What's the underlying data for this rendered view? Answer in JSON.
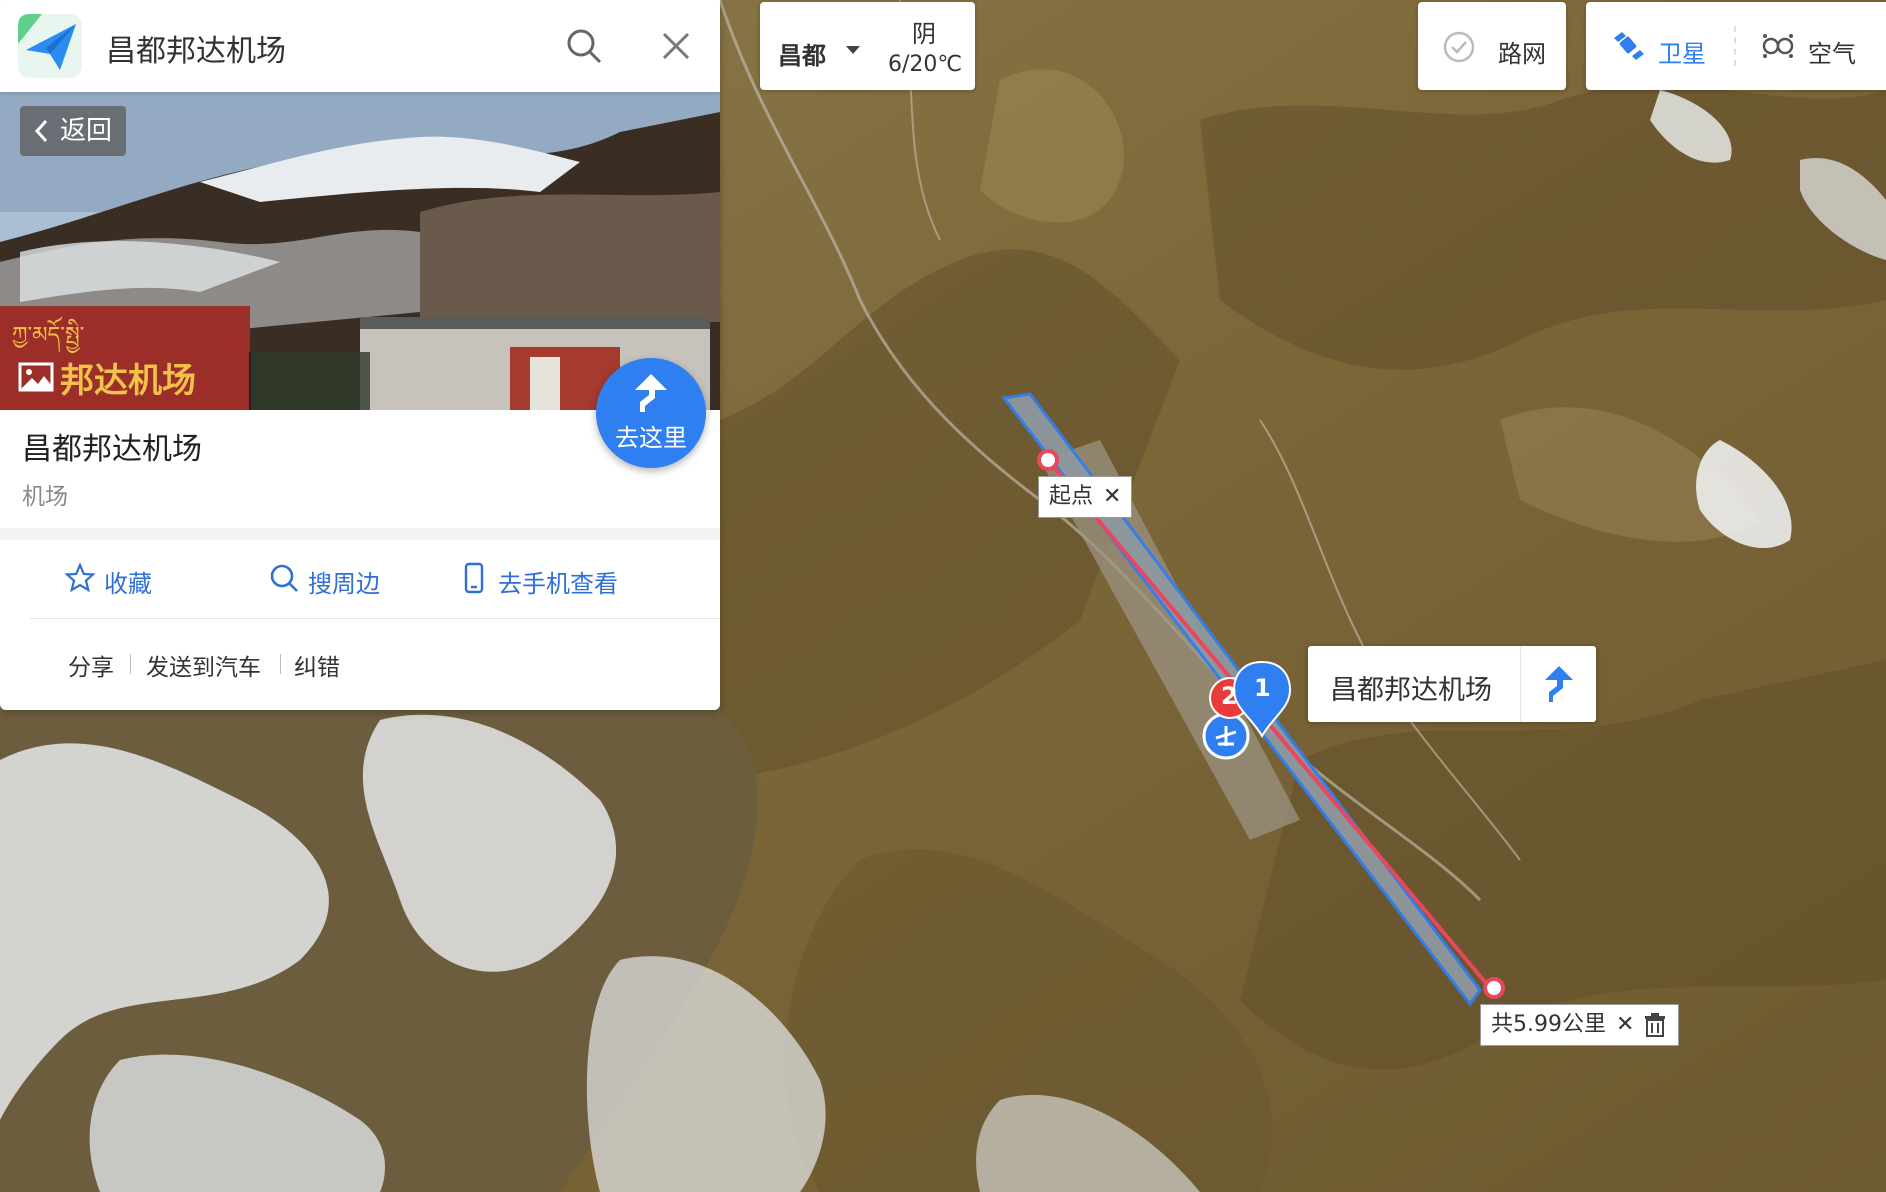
{
  "search": {
    "query": "昌都邦达机场"
  },
  "panel": {
    "back_label": "返回",
    "goto_label": "去这里",
    "title": "昌都邦达机场",
    "category": "机场",
    "photo_sign_text": "邦达机场",
    "actions": [
      {
        "label": "收藏",
        "icon": "star-icon"
      },
      {
        "label": "搜周边",
        "icon": "search-icon"
      },
      {
        "label": "去手机查看",
        "icon": "phone-icon"
      }
    ],
    "links": [
      "分享",
      "发送到汽车",
      "纠错"
    ]
  },
  "weather": {
    "city": "昌都",
    "condition": "阴",
    "temperature": "6/20℃"
  },
  "controls": {
    "roadnet_label": "路网",
    "layers": [
      {
        "label": "卫星",
        "icon": "satellite-icon",
        "active": true
      },
      {
        "label": "空气",
        "icon": "air-icon",
        "active": false
      }
    ]
  },
  "map": {
    "start_label": "起点",
    "distance_label": "共5.99公里",
    "poi_name": "昌都邦达机场",
    "marker_1": "1",
    "marker_2": "2",
    "colors": {
      "accent": "#2f7ff0",
      "route": "#e8475d",
      "terrain": "#8a7646",
      "snow": "#e9ecef"
    }
  }
}
